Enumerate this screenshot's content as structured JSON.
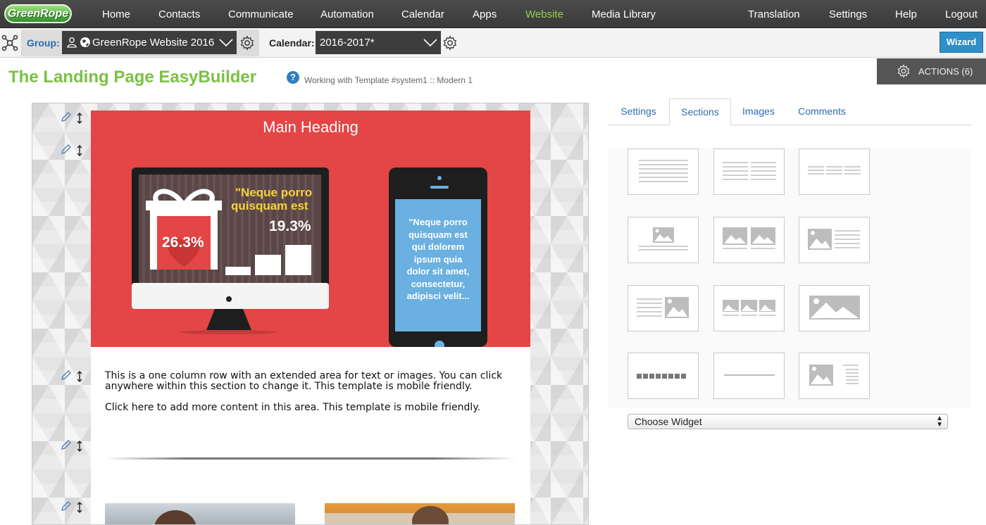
{
  "logo": {
    "text": "GreenRope"
  },
  "nav": {
    "items": [
      {
        "label": "Home"
      },
      {
        "label": "Contacts"
      },
      {
        "label": "Communicate"
      },
      {
        "label": "Automation"
      },
      {
        "label": "Calendar"
      },
      {
        "label": "Apps"
      },
      {
        "label": "Website",
        "active": true
      },
      {
        "label": "Media Library"
      }
    ],
    "right": [
      {
        "label": "Translation"
      },
      {
        "label": "Settings"
      },
      {
        "label": "Help"
      },
      {
        "label": "Logout"
      }
    ]
  },
  "toolbar": {
    "group_label": "Group:",
    "group_value": "GreenRope Website 2016",
    "calendar_label": "Calendar:",
    "calendar_value": "2016-2017*",
    "wizard_label": "Wizard"
  },
  "header": {
    "title": "The Landing Page EasyBuilder",
    "help": "?",
    "subtitle": "Working with Template #system1 :: Modern 1",
    "actions_label": "ACTIONS (6)"
  },
  "editor": {
    "hero_heading": "Main Heading",
    "monitor_quote": "\"Neque porro quisquam est",
    "monitor_quote_line1": "\"Neque porro",
    "monitor_quote_line2": "quisquam est",
    "stat_big": "19.3%",
    "stat_heart": "26.3%",
    "phone_text_lines": [
      "\"Neque porro",
      "quisquam est",
      "qui dolorem",
      "ipsum quia",
      "dolor sit amet,",
      "consectetur,",
      "adipisci velit..."
    ],
    "body_line1": "This is a one column row with an extended area for text or images. You can click anywhere within this section to change it. This template is mobile friendly.",
    "body_line2": "Click here to add more content in this area. This template is mobile friendly."
  },
  "panel": {
    "tabs": [
      {
        "label": "Settings"
      },
      {
        "label": "Sections",
        "active": true
      },
      {
        "label": "Images"
      },
      {
        "label": "Comments"
      }
    ],
    "widget_select": "Choose Widget"
  },
  "colors": {
    "nav_bg": "#3f3f3f",
    "nav_active": "#8fd14f",
    "title_green": "#7ac143",
    "hero_red": "#e44545",
    "link_blue": "#2d6db0",
    "wizard_blue": "#2f8fc9"
  },
  "icons": [
    "network-icon",
    "user-icon",
    "globe-icon",
    "chevron-down-icon",
    "gear-icon",
    "help-icon",
    "pencil-icon",
    "move-icon"
  ]
}
